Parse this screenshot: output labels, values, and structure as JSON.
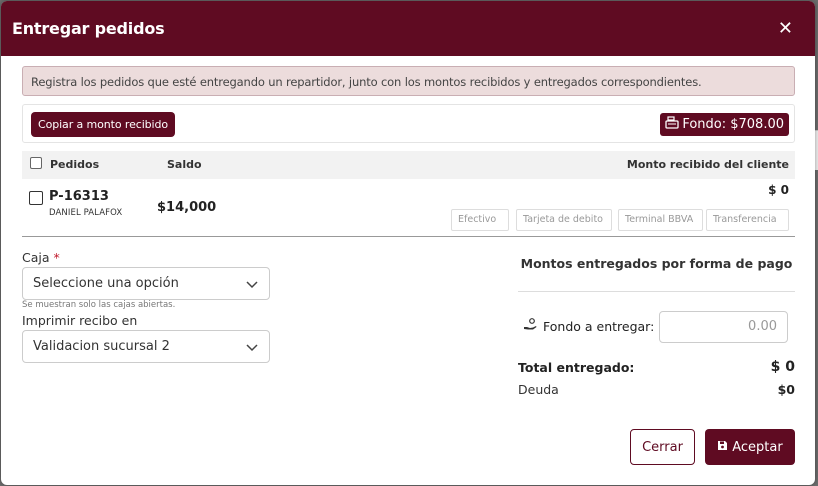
{
  "modal": {
    "title": "Entregar pedidos",
    "close_icon": "close-icon"
  },
  "alert": {
    "text": "Registra los pedidos que esté entregando un repartidor, junto con los montos recibidos y entregados correspondientes."
  },
  "toolbar": {
    "copy_label": "Copiar a monto recibido",
    "fondo_label": "Fondo: $708.00",
    "fondo_icon": "cash-register-icon"
  },
  "table": {
    "headers": {
      "pedidos": "Pedidos",
      "saldo": "Saldo",
      "monto": "Monto recibido del cliente"
    },
    "rows": [
      {
        "id": "P-16313",
        "client": "DANIEL PALAFOX",
        "saldo": "$14,000",
        "recibido": "$ 0",
        "payments": [
          "Efectivo",
          "Tarjeta de debito",
          "Terminal BBVA",
          "Transferencia"
        ]
      }
    ]
  },
  "form": {
    "caja_label": "Caja",
    "caja_required": "*",
    "caja_placeholder": "Seleccione una opción",
    "caja_hint": "Se muestran solo las cajas abiertas.",
    "imprimir_label": "Imprimir recibo en",
    "imprimir_value": "Validacion sucursal 2"
  },
  "summary": {
    "title": "Montos entregados por forma de pago",
    "fondo_label": "Fondo a entregar:",
    "fondo_icon": "hand-coin-icon",
    "fondo_placeholder": "0.00",
    "total_label": "Total entregado:",
    "total_value": "$ 0",
    "debt_label": "Deuda",
    "debt_value": "$0"
  },
  "footer": {
    "cancel_label": "Cerrar",
    "ok_label": "Aceptar",
    "ok_icon": "save-icon"
  },
  "colors": {
    "primary": "#5f0b22",
    "alert_bg": "#ecdcdc"
  }
}
